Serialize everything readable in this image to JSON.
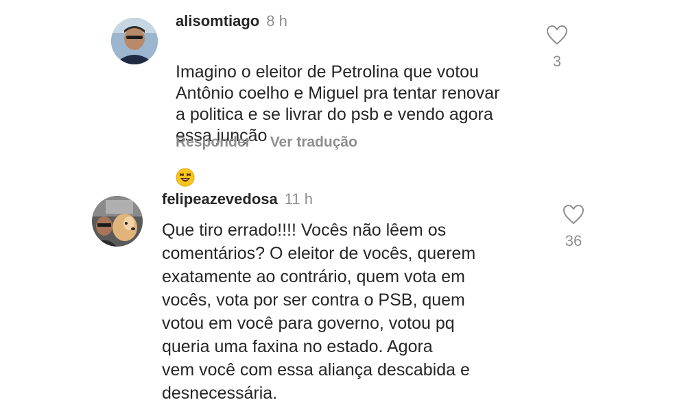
{
  "comments": [
    {
      "username": "alisomtiago",
      "time": "8 h",
      "text": "Imagino o eleitor de Petrolina que votou\nAntônio coelho e Miguel pra tentar renovar\na politica e se livrar do psb e vendo agora\nessa junção",
      "emoji": "laughing-face",
      "like_count": "3",
      "actions": {
        "reply": "Responder",
        "translate": "Ver tradução"
      }
    },
    {
      "username": "felipeazevedosa",
      "time": "11 h",
      "text": "Que tiro errado!!!! Vocês não lêem os\ncomentários? O eleitor de vocês, querem\nexatamente ao contrário, quem vota em\nvocês, vota por ser contra o PSB, quem\nvotou em você para governo, votou pq\nqueria uma faxina no estado. Agora\nvem você com essa aliança descabida e\ndesnecessária.",
      "like_count": "36"
    }
  ],
  "colors": {
    "text": "#262626",
    "secondary": "#8e8e8e",
    "background": "#ffffff"
  }
}
